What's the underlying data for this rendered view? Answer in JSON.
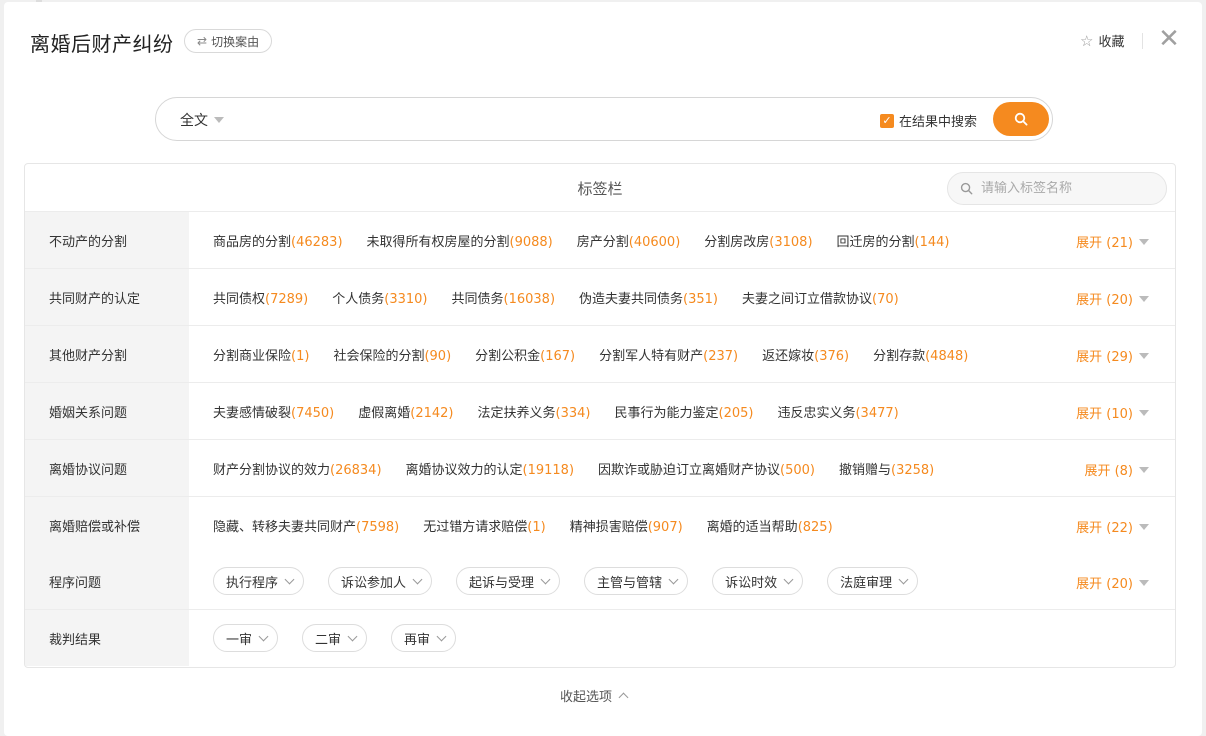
{
  "header": {
    "title": "离婚后财产纠纷",
    "switch_label": "切换案由",
    "favorite_label": "收藏"
  },
  "search": {
    "type_label": "全文",
    "value": "",
    "in_result_label": "在结果中搜索",
    "in_result_checked": true
  },
  "tags": {
    "title": "标签栏",
    "search_placeholder": "请输入标签名称",
    "rows": [
      {
        "label": "不动产的分割",
        "expand": "展开 (21)",
        "items": [
          {
            "name": "商品房的分割",
            "count": "(46283)"
          },
          {
            "name": "未取得所有权房屋的分割",
            "count": "(9088)"
          },
          {
            "name": "房产分割",
            "count": "(40600)"
          },
          {
            "name": "分割房改房",
            "count": "(3108)"
          },
          {
            "name": "回迁房的分割",
            "count": "(144)"
          }
        ]
      },
      {
        "label": "共同财产的认定",
        "expand": "展开 (20)",
        "items": [
          {
            "name": "共同债权",
            "count": "(7289)"
          },
          {
            "name": "个人债务",
            "count": "(3310)"
          },
          {
            "name": "共同债务",
            "count": "(16038)"
          },
          {
            "name": "伪造夫妻共同债务",
            "count": "(351)"
          },
          {
            "name": "夫妻之间订立借款协议",
            "count": "(70)"
          }
        ]
      },
      {
        "label": "其他财产分割",
        "expand": "展开 (29)",
        "items": [
          {
            "name": "分割商业保险",
            "count": "(1)"
          },
          {
            "name": "社会保险的分割",
            "count": "(90)"
          },
          {
            "name": "分割公积金",
            "count": "(167)"
          },
          {
            "name": "分割军人特有财产",
            "count": "(237)"
          },
          {
            "name": "返还嫁妆",
            "count": "(376)"
          },
          {
            "name": "分割存款",
            "count": "(4848)"
          }
        ]
      },
      {
        "label": "婚姻关系问题",
        "expand": "展开 (10)",
        "items": [
          {
            "name": "夫妻感情破裂",
            "count": "(7450)"
          },
          {
            "name": "虚假离婚",
            "count": "(2142)"
          },
          {
            "name": "法定扶养义务",
            "count": "(334)"
          },
          {
            "name": "民事行为能力鉴定",
            "count": "(205)"
          },
          {
            "name": "违反忠实义务",
            "count": "(3477)"
          }
        ]
      },
      {
        "label": "离婚协议问题",
        "expand": "展开 (8)",
        "items": [
          {
            "name": "财产分割协议的效力",
            "count": "(26834)"
          },
          {
            "name": "离婚协议效力的认定",
            "count": "(19118)"
          },
          {
            "name": "因欺诈或胁迫订立离婚财产协议",
            "count": "(500)"
          },
          {
            "name": "撤销赠与",
            "count": "(3258)"
          }
        ]
      },
      {
        "label": "离婚赔偿或补偿",
        "expand": "展开 (22)",
        "items": [
          {
            "name": "隐藏、转移夫妻共同财产",
            "count": "(7598)"
          },
          {
            "name": "无过错方请求赔偿",
            "count": "(1)"
          },
          {
            "name": "精神损害赔偿",
            "count": "(907)"
          },
          {
            "name": "离婚的适当帮助",
            "count": "(825)"
          }
        ]
      }
    ],
    "procedure": {
      "label": "程序问题",
      "expand": "展开 (20)",
      "pills": [
        "执行程序",
        "诉讼参加人",
        "起诉与受理",
        "主管与管辖",
        "诉讼时效",
        "法庭审理"
      ]
    },
    "judgment": {
      "label": "裁判结果",
      "pills": [
        "一审",
        "二审",
        "再审"
      ]
    }
  },
  "footer": {
    "collapse_label": "收起选项"
  },
  "colors": {
    "accent": "#f58a1f",
    "label_bg": "#f4f4f4",
    "border": "#ececec"
  }
}
